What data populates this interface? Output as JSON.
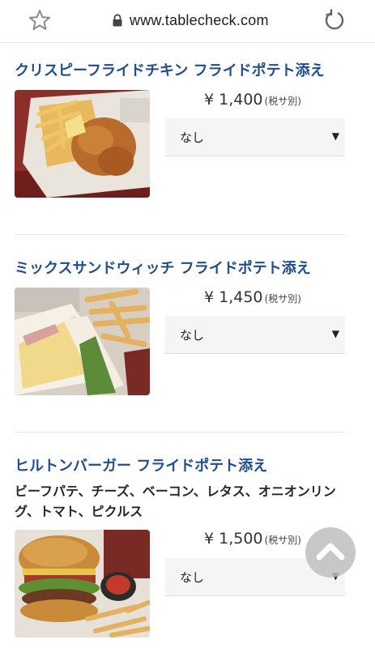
{
  "browser": {
    "url": "www.tablecheck.com",
    "star_icon": "star-icon",
    "lock_icon": "lock-icon",
    "reload_icon": "reload-icon"
  },
  "items": [
    {
      "title": "クリスピーフライドチキン フライドポテト添え",
      "price": "¥ 1,400",
      "tax_note": "(税サ別)",
      "option": "なし",
      "photo": "fried-chicken-photo"
    },
    {
      "title": "ミックスサンドウィッチ フライドポテト添え",
      "price": "¥ 1,450",
      "tax_note": "(税サ別)",
      "option": "なし",
      "photo": "sandwich-photo"
    },
    {
      "title": "ヒルトンバーガー フライドポテト添え",
      "description": "ビーフパテ、チーズ、ベーコン、レタス、オニオンリング、トマト、ピクルス",
      "price": "¥ 1,500",
      "tax_note": "(税サ別)",
      "option": "なし",
      "photo": "burger-photo"
    }
  ],
  "scroll_top_icon": "chevron-up-icon",
  "colors": {
    "title": "#1f4e8a",
    "select_bg": "#f5f5f5"
  }
}
